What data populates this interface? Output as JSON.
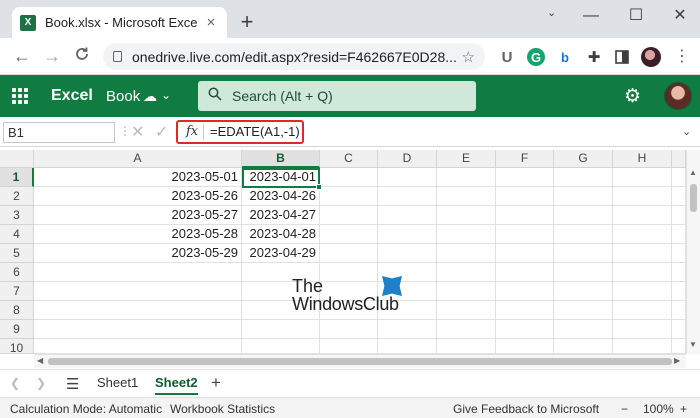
{
  "browser": {
    "tab_title": "Book.xlsx - Microsoft Excel Online",
    "tab_close": "×",
    "new_tab": "+",
    "url": "onedrive.live.com/edit.aspx?resid=F462667E0D28...",
    "back": "←",
    "forward": "→",
    "reload": "C",
    "minimize": "—",
    "maximize": "☐",
    "close": "✕",
    "collapse": "⌄"
  },
  "excel": {
    "app_name": "Excel",
    "book_name": "Book",
    "search_placeholder": "Search (Alt + Q)"
  },
  "formula_bar": {
    "name_box": "B1",
    "fx": "fx",
    "formula": "=EDATE(A1,-1)"
  },
  "grid": {
    "columns": [
      "A",
      "B",
      "C",
      "D",
      "E",
      "F",
      "G",
      "H"
    ],
    "rows": [
      "1",
      "2",
      "3",
      "4",
      "5",
      "6",
      "7",
      "8",
      "9",
      "10"
    ],
    "col_a": [
      "2023-05-01",
      "2023-05-26",
      "2023-05-27",
      "2023-05-28",
      "2023-05-29"
    ],
    "col_b": [
      "2023-04-01",
      "2023-04-26",
      "2023-04-27",
      "2023-04-28",
      "2023-04-29"
    ],
    "selected_cell": "B1"
  },
  "watermark": {
    "line1": "The",
    "line2": "WindowsClub"
  },
  "sheets": {
    "tabs": [
      "Sheet1",
      "Sheet2"
    ],
    "active": "Sheet2",
    "add": "+"
  },
  "status": {
    "calc_mode": "Calculation Mode: Automatic",
    "workbook_stats": "Workbook Statistics",
    "feedback": "Give Feedback to Microsoft",
    "zoom": "100%",
    "minus": "−",
    "plus": "+"
  },
  "colors": {
    "brand_green": "#107c41",
    "highlight_red": "#e02828"
  }
}
